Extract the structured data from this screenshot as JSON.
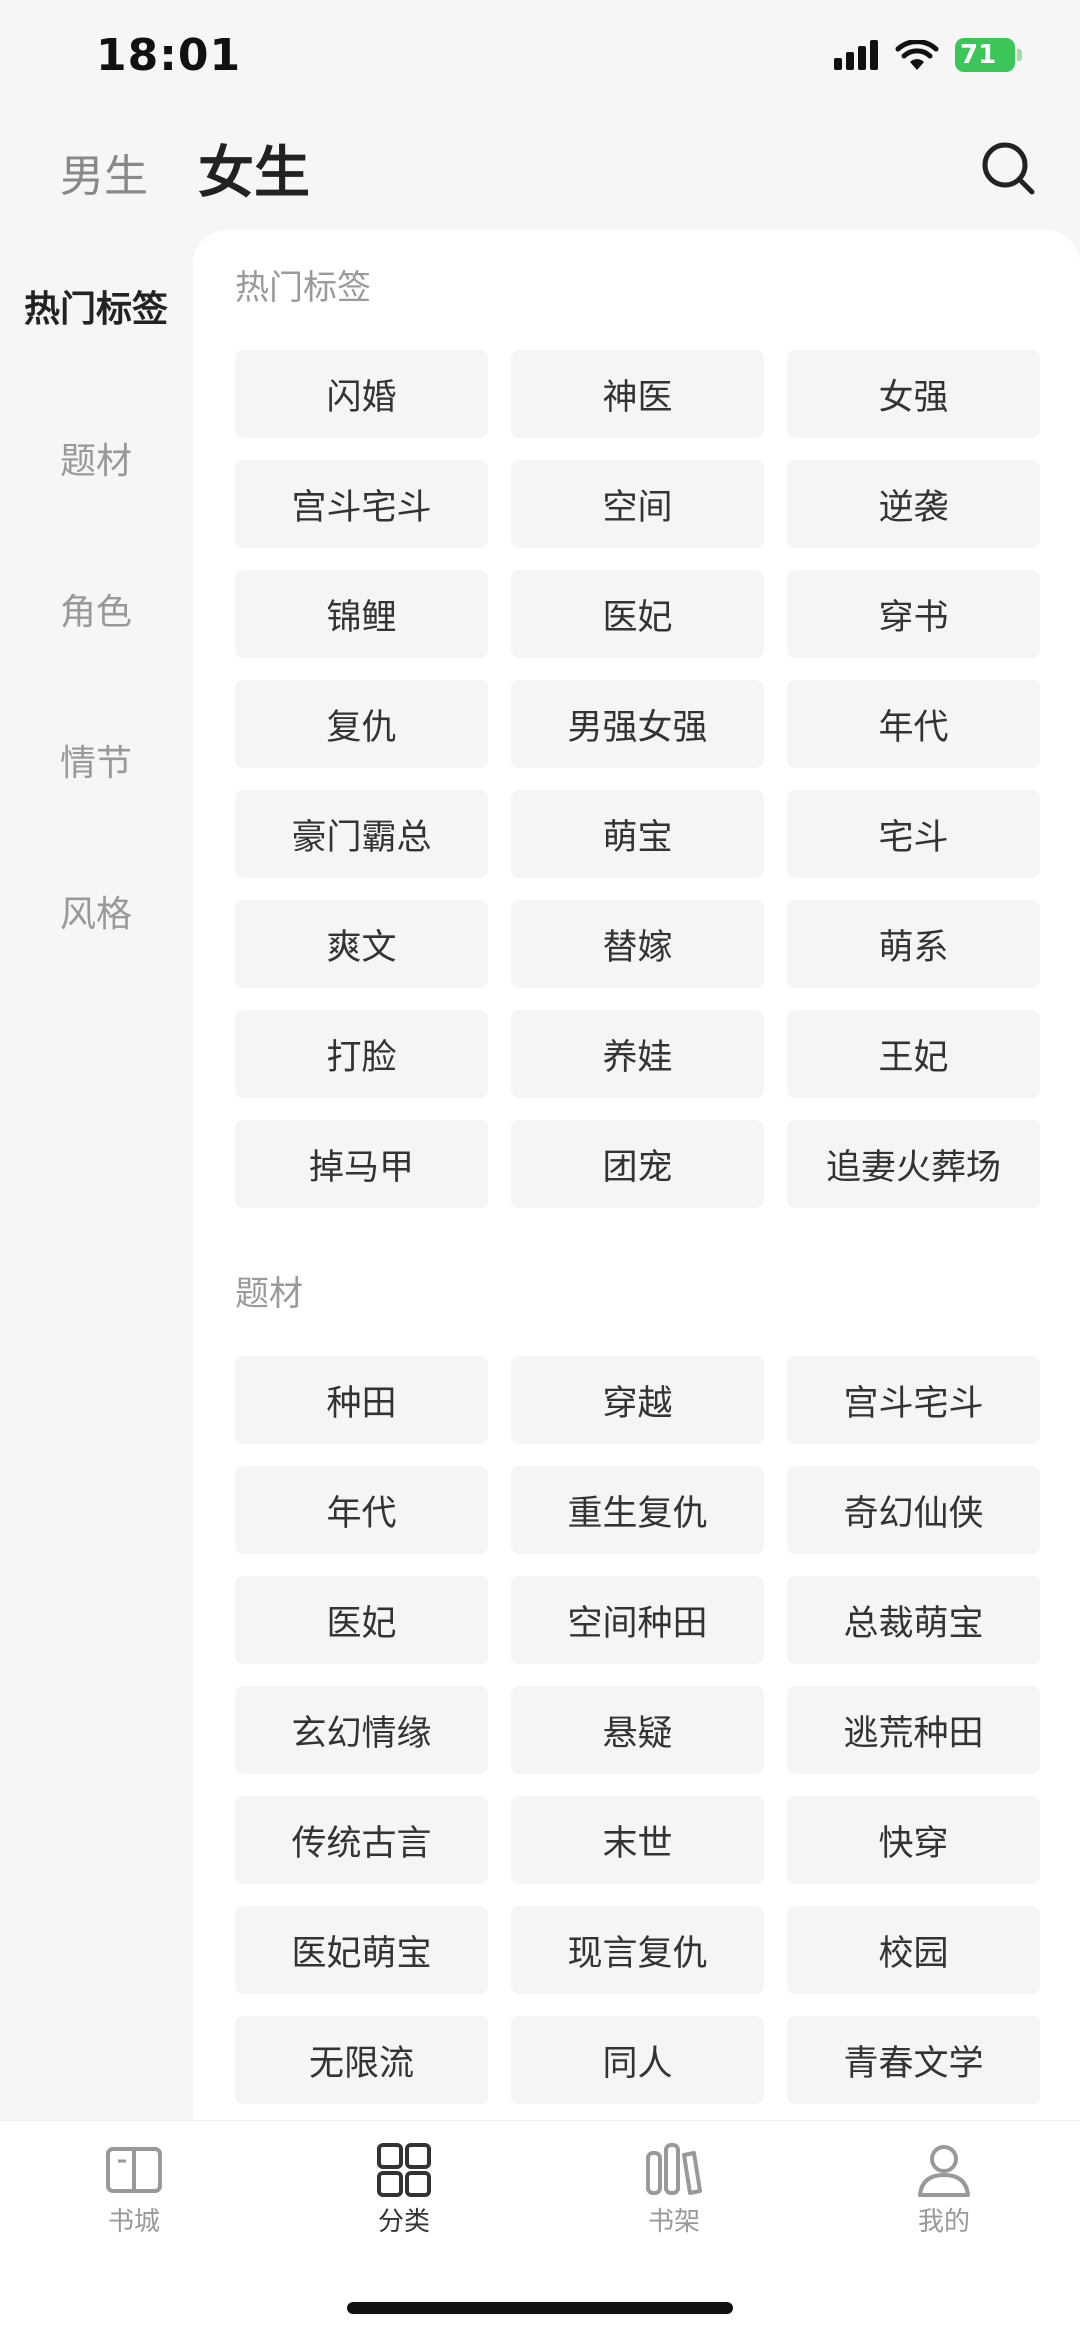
{
  "status": {
    "time": "18:01",
    "battery": "71"
  },
  "header": {
    "male_label": "男生",
    "female_label": "女生"
  },
  "sidebar": {
    "items": [
      {
        "label": "热门标签",
        "active": true
      },
      {
        "label": "题材",
        "active": false
      },
      {
        "label": "角色",
        "active": false
      },
      {
        "label": "情节",
        "active": false
      },
      {
        "label": "风格",
        "active": false
      }
    ]
  },
  "sections": [
    {
      "title": "热门标签",
      "tags": [
        "闪婚",
        "神医",
        "女强",
        "宫斗宅斗",
        "空间",
        "逆袭",
        "锦鲤",
        "医妃",
        "穿书",
        "复仇",
        "男强女强",
        "年代",
        "豪门霸总",
        "萌宝",
        "宅斗",
        "爽文",
        "替嫁",
        "萌系",
        "打脸",
        "养娃",
        "王妃",
        "掉马甲",
        "团宠",
        "追妻火葬场"
      ]
    },
    {
      "title": "题材",
      "tags": [
        "种田",
        "穿越",
        "宫斗宅斗",
        "年代",
        "重生复仇",
        "奇幻仙侠",
        "医妃",
        "空间种田",
        "总裁萌宝",
        "玄幻情缘",
        "悬疑",
        "逃荒种田",
        "传统古言",
        "末世",
        "快穿",
        "医妃萌宝",
        "现言复仇",
        "校园",
        "无限流",
        "同人",
        "青春文学"
      ]
    }
  ],
  "tabbar": {
    "items": [
      {
        "label": "书城",
        "icon": "book-open-icon",
        "active": false
      },
      {
        "label": "分类",
        "icon": "grid-icon",
        "active": true
      },
      {
        "label": "书架",
        "icon": "bookshelf-icon",
        "active": false
      },
      {
        "label": "我的",
        "icon": "person-icon",
        "active": false
      }
    ]
  }
}
